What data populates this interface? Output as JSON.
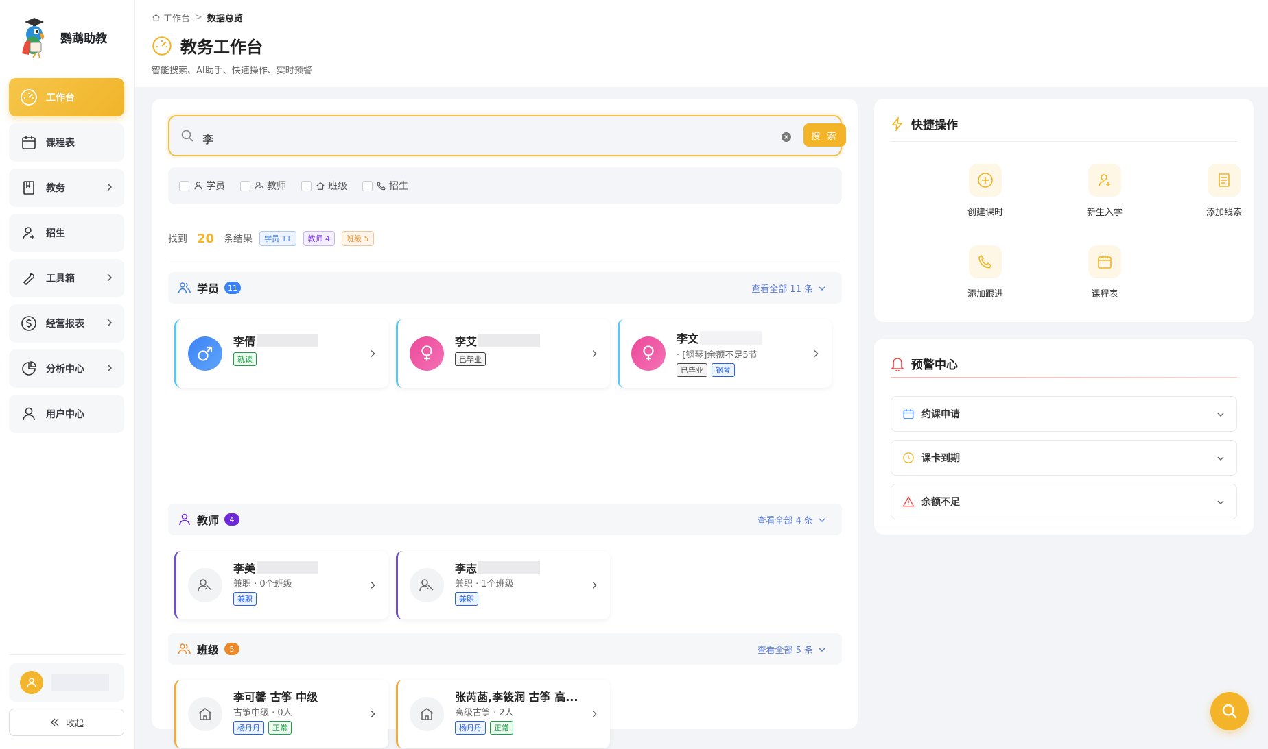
{
  "app": {
    "name": "鹦鹉助教"
  },
  "sidebar": {
    "items": [
      {
        "label": "工作台",
        "icon": "dashboard-icon",
        "active": true
      },
      {
        "label": "课程表",
        "icon": "calendar-icon"
      },
      {
        "label": "教务",
        "icon": "book-icon",
        "has_submenu": true
      },
      {
        "label": "招生",
        "icon": "user-plus-icon"
      },
      {
        "label": "工具箱",
        "icon": "wrench-icon",
        "has_submenu": true
      },
      {
        "label": "经营报表",
        "icon": "dollar-icon",
        "has_submenu": true
      },
      {
        "label": "分析中心",
        "icon": "pie-chart-icon",
        "has_submenu": true
      },
      {
        "label": "用户中心",
        "icon": "user-icon"
      }
    ],
    "collapse_label": "收起"
  },
  "header": {
    "breadcrumb": [
      "工作台",
      "数据总览"
    ],
    "title": "教务工作台",
    "subtitle": "智能搜索、AI助手、快速操作、实时预警"
  },
  "search": {
    "query": "李",
    "button_label": "搜 索",
    "filters": [
      "学员",
      "教师",
      "班级",
      "招生"
    ]
  },
  "results": {
    "prefix": "找到",
    "count": "20",
    "suffix": "条结果",
    "tags": [
      "学员 11",
      "教师 4",
      "班级 5"
    ]
  },
  "sections": {
    "students": {
      "title": "学员",
      "count": "11",
      "view_all": "查看全部 11 条",
      "items": [
        {
          "name": "李倩",
          "tags": [
            "就读"
          ]
        },
        {
          "name": "李艾",
          "tags": [
            "已毕业"
          ]
        },
        {
          "name": "李文",
          "meta": "· [钢琴]余额不足5节",
          "tags": [
            "已毕业",
            "钢琴"
          ]
        }
      ]
    },
    "teachers": {
      "title": "教师",
      "count": "4",
      "view_all": "查看全部 4 条",
      "items": [
        {
          "name": "李美",
          "meta": "兼职 · 0个班级",
          "tags": [
            "兼职"
          ]
        },
        {
          "name": "李志",
          "meta": "兼职 · 1个班级",
          "tags": [
            "兼职"
          ]
        }
      ]
    },
    "classes": {
      "title": "班级",
      "count": "5",
      "view_all": "查看全部 5 条",
      "items": [
        {
          "name": "李可馨 古筝 中级",
          "meta": "古筝中级 · 0人",
          "tags": [
            "杨丹丹",
            "正常"
          ]
        },
        {
          "name": "张芮菡,李筱润 古筝 高...",
          "meta": "高级古筝 · 2人",
          "tags": [
            "杨丹丹",
            "正常"
          ]
        }
      ]
    }
  },
  "quick_actions": {
    "title": "快捷操作",
    "items": [
      {
        "label": "创建课时",
        "icon": "plus-circle-icon"
      },
      {
        "label": "新生入学",
        "icon": "user-add-icon"
      },
      {
        "label": "添加线索",
        "icon": "document-icon"
      },
      {
        "label": "添加跟进",
        "icon": "phone-icon"
      },
      {
        "label": "课程表",
        "icon": "calendar-icon"
      }
    ]
  },
  "alerts": {
    "title": "预警中心",
    "items": [
      {
        "label": "约课申请",
        "icon": "calendar-icon"
      },
      {
        "label": "课卡到期",
        "icon": "clock-icon"
      },
      {
        "label": "余额不足",
        "icon": "warning-icon"
      }
    ]
  },
  "colors": {
    "accent": "#f3b42a",
    "blue": "#3b82f6",
    "purple": "#6d28d9",
    "orange": "#ea8a2a",
    "pink": "#ec4899",
    "danger": "#ef4444"
  }
}
